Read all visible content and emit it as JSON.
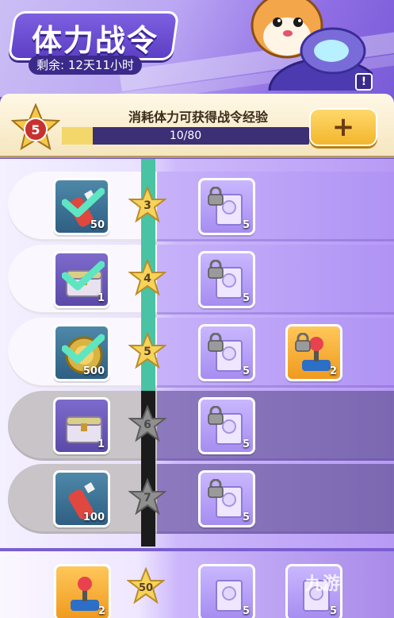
{
  "header": {
    "title": "体力战令",
    "remaining": "剩余: 12天11小时",
    "info_glyph": "!"
  },
  "progress": {
    "level": "5",
    "task_text": "消耗体力可获得战令经验",
    "current": 10,
    "max": 80,
    "text": "10/80",
    "plus_glyph": "+"
  },
  "rows": [
    {
      "level": "3",
      "free_qty": "50",
      "free_item": "bottle-item",
      "claimed": true,
      "paid": [
        {
          "qty": "5",
          "item": "scroll-item",
          "locked": true
        }
      ]
    },
    {
      "level": "4",
      "free_qty": "1",
      "free_item": "chest-item",
      "claimed": true,
      "paid": [
        {
          "qty": "5",
          "item": "scroll-item",
          "locked": true
        }
      ]
    },
    {
      "level": "5",
      "free_qty": "500",
      "free_item": "coin-item",
      "claimed": true,
      "paid": [
        {
          "qty": "5",
          "item": "scroll-item",
          "locked": true
        },
        {
          "qty": "2",
          "item": "joystick-item",
          "locked": true
        }
      ]
    },
    {
      "level": "6",
      "free_qty": "1",
      "free_item": "chest-item",
      "claimed": false,
      "paid": [
        {
          "qty": "5",
          "item": "scroll-item",
          "locked": true
        }
      ]
    },
    {
      "level": "7",
      "free_qty": "100",
      "free_item": "bottle-item",
      "claimed": false,
      "paid": [
        {
          "qty": "5",
          "item": "scroll-item",
          "locked": true
        }
      ]
    }
  ],
  "bottom": {
    "level": "50",
    "free_qty": "2",
    "paid_qty_1": "5",
    "paid_qty_2": "5"
  },
  "watermark": "九游",
  "colors": {
    "accent_purple": "#6f56c6",
    "track_green": "#49c3a4",
    "gold": "#f3b62d"
  }
}
